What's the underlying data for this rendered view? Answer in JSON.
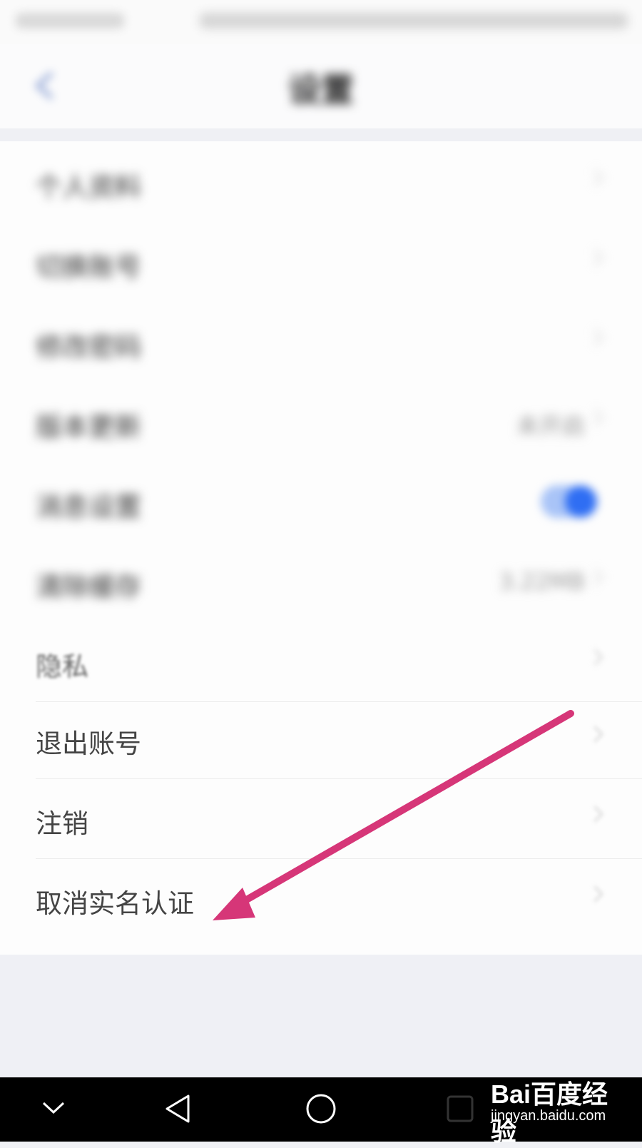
{
  "status_bar": {
    "carrier": "",
    "indicators": ""
  },
  "header": {
    "title": "设置",
    "back_icon": "back-arrow-icon"
  },
  "settings": {
    "items": [
      {
        "label": "个人资料",
        "value": ""
      },
      {
        "label": "切换账号",
        "value": ""
      },
      {
        "label": "修改密码",
        "value": ""
      },
      {
        "label": "版本更新",
        "value": "未开启"
      },
      {
        "label": "消息设置",
        "toggle": true
      },
      {
        "label": "清除缓存",
        "value": "3.22MB"
      },
      {
        "label": "隐私",
        "value": ""
      },
      {
        "label": "退出账号",
        "value": ""
      },
      {
        "label": "注销",
        "value": ""
      },
      {
        "label": "取消实名认证",
        "value": ""
      }
    ]
  },
  "annotation": {
    "type": "arrow",
    "color": "#d63678",
    "points_to": "取消实名认证"
  },
  "system_nav": {
    "keys": [
      "chevron-down-icon",
      "back-triangle-icon",
      "home-circle-icon",
      "recents-square-icon"
    ]
  },
  "watermark": {
    "logo": "Bai百度经验",
    "url": "jingyan.baidu.com"
  },
  "colors": {
    "accent": "#2f6ef3",
    "background": "#f0f1f5",
    "arrow": "#d63678"
  }
}
